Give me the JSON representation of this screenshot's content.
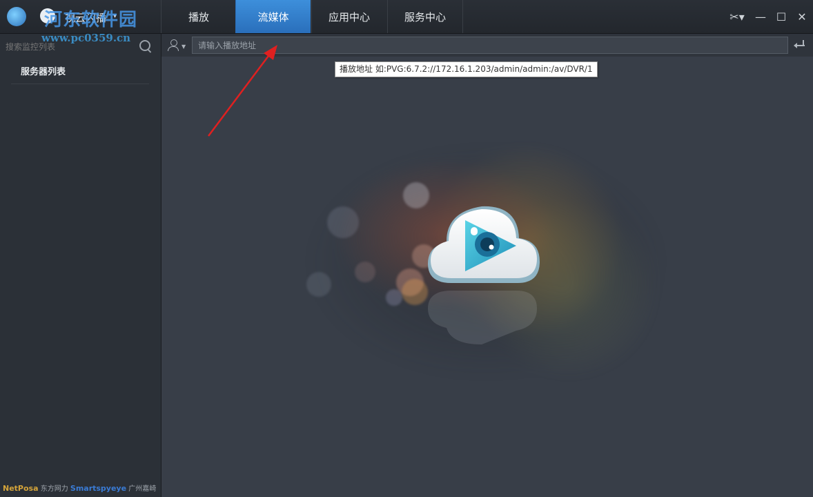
{
  "app": {
    "title": "视云闪播",
    "title_caret": "▾"
  },
  "watermark": {
    "name": "河东软件园",
    "url": "www.pc0359.cn"
  },
  "tabs": [
    {
      "label": "播放",
      "active": false
    },
    {
      "label": "流媒体",
      "active": true
    },
    {
      "label": "应用中心",
      "active": false
    },
    {
      "label": "服务中心",
      "active": false
    }
  ],
  "window_controls": {
    "skin": "✂▾",
    "minimize": "—",
    "maximize": "☐",
    "close": "✕"
  },
  "sidebar": {
    "search_placeholder": "搜索监控列表",
    "server_list_label": "服务器列表",
    "footer": {
      "netposa": "NetPosa",
      "netposa_cn": "东方网力",
      "smartspyeye": "Smartspyeye",
      "smartspyeye_cn": "广州嘉崎"
    }
  },
  "main": {
    "url_placeholder": "请输入播放地址",
    "tooltip": "播放地址 如:PVG:6.7.2://172.16.1.203/admin/admin:/av/DVR/1"
  },
  "colors": {
    "accent": "#2f80d1",
    "background": "#383e48",
    "sidebar": "#2b3037",
    "annotation_arrow": "#e02020"
  },
  "icons": {
    "search": "search-icon",
    "user": "user-icon",
    "enter": "enter-icon",
    "logo": "cloud-play-logo"
  }
}
